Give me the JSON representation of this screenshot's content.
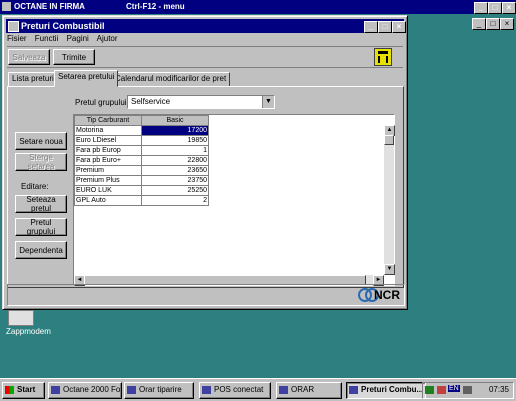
{
  "desktop": {
    "app_title": "OCTANE IN FIRMA",
    "app_subtitle": "Ctrl-F12 - menu",
    "icon_label": "Zappmodem"
  },
  "window": {
    "title": "Preturi Combustibil"
  },
  "menu": [
    {
      "label": "Fisier"
    },
    {
      "label": "Functii"
    },
    {
      "label": "Pagini"
    },
    {
      "label": "Ajutor"
    }
  ],
  "toolbar": {
    "save_label": "Salveaza",
    "send_label": "Trimite"
  },
  "tabs": [
    {
      "label": "Lista preturi"
    },
    {
      "label": "Setarea pretului"
    },
    {
      "label": "Calendarul modificarilor de pret"
    }
  ],
  "form": {
    "group_price_label": "Pretul grupului",
    "group_price_value": "Selfservice"
  },
  "side_buttons": {
    "new_setting": "Setare noua",
    "delete_setting": "Sterge setarea",
    "edit_label": "Editare:",
    "set_price": "Seteaza pretul",
    "group_price": "Pretul grupului",
    "dependency": "Dependenta"
  },
  "grid": {
    "headers": [
      "Tip Carburant",
      "Basic"
    ],
    "rows": [
      {
        "fuel": "Motorina",
        "basic": "17200"
      },
      {
        "fuel": "Euro LDiesel",
        "basic": "19850"
      },
      {
        "fuel": "Fara pb Europ",
        "basic": "1"
      },
      {
        "fuel": "Fara pb Euro+",
        "basic": "22800"
      },
      {
        "fuel": "Premium",
        "basic": "23650"
      },
      {
        "fuel": "Premium Plus",
        "basic": "23750"
      },
      {
        "fuel": "EURO LUK",
        "basic": "25250"
      },
      {
        "fuel": "GPL Auto",
        "basic": "2"
      }
    ]
  },
  "logo": {
    "text": "NCR"
  },
  "taskbar": {
    "start_label": "Start",
    "tasks": [
      {
        "label": "Octane 2000 Fo..."
      },
      {
        "label": "Orar tiparire"
      },
      {
        "label": "POS conectat"
      },
      {
        "label": "ORAR"
      },
      {
        "label": "Preturi Combu..."
      }
    ],
    "lang": "EN",
    "clock": "07:35"
  },
  "colors": {
    "titlebar": "#000080",
    "desktop": "#2e7f7f",
    "face": "#c0c0c0",
    "selection": "#000080"
  }
}
